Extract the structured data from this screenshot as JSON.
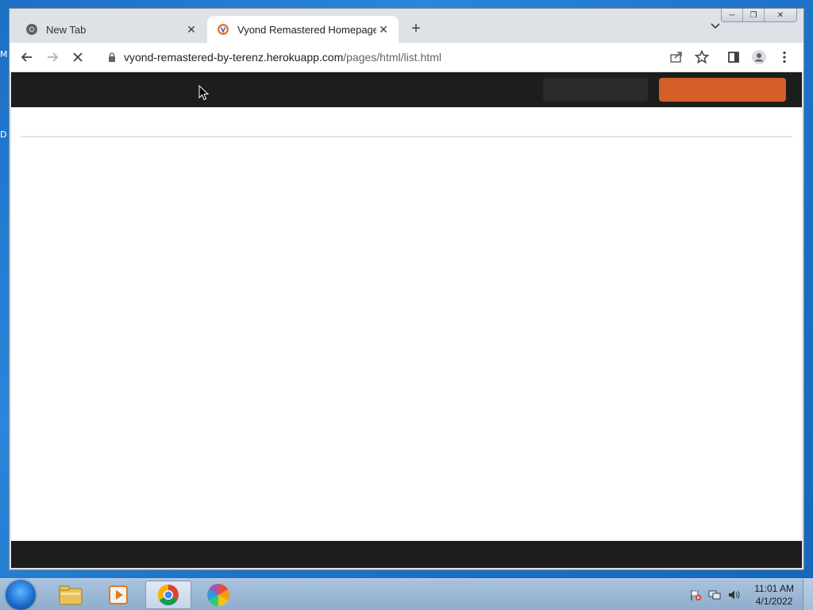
{
  "desktop": {
    "fragments": [
      "M",
      "D"
    ]
  },
  "browser": {
    "tabs": [
      {
        "label": "New Tab",
        "active": false,
        "icon": "chrome-icon"
      },
      {
        "label": "Vyond Remastered Homepage",
        "active": true,
        "icon": "vyond-favicon"
      }
    ],
    "address": {
      "host": "vyond-remastered-by-terenz.herokuapp.com",
      "path": "/pages/html/list.html"
    },
    "loading": true
  },
  "page": {
    "nav_color": "#1d1d1d",
    "accent": "#d45f26"
  },
  "taskbar": {
    "pinned": [
      "explorer-icon",
      "media-player-icon",
      "chrome-icon",
      "photos-icon"
    ],
    "active": "chrome-icon",
    "clock": {
      "time": "11:01 AM",
      "date": "4/1/2022"
    }
  }
}
